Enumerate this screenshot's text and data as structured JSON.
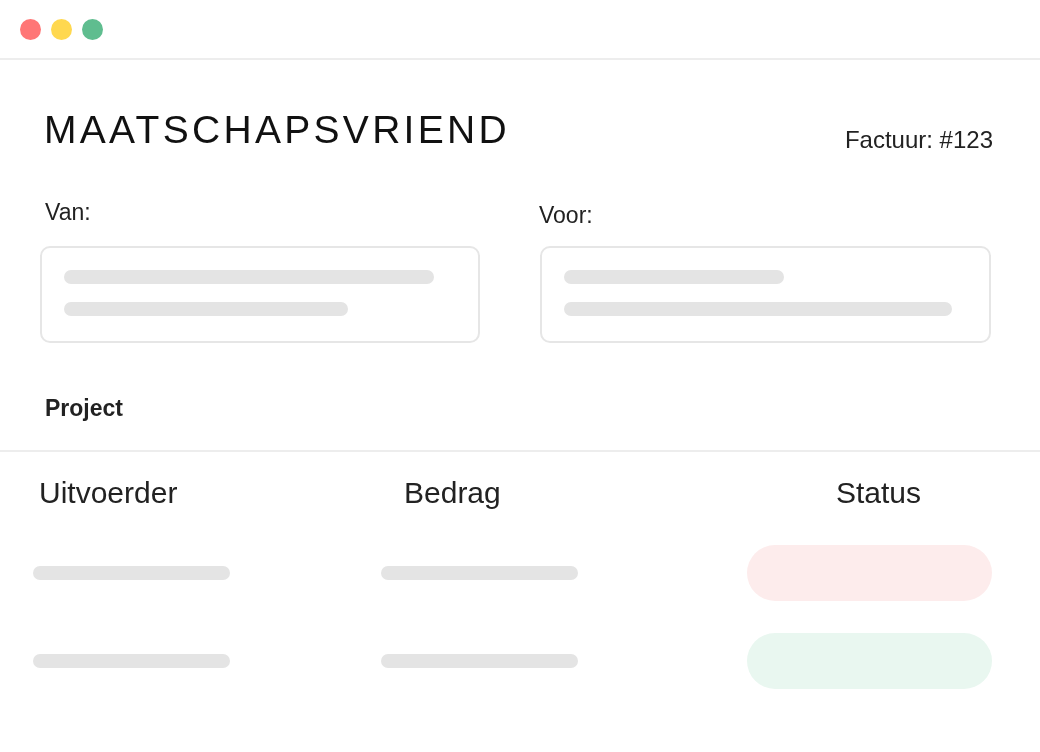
{
  "window": {
    "controls": [
      {
        "kind": "close"
      },
      {
        "kind": "minimize"
      },
      {
        "kind": "maximize"
      }
    ]
  },
  "logo": {
    "text": "MAATSCHAPSVRIEND"
  },
  "invoice_number": "Factuur: #123",
  "from": {
    "label": "Van:"
  },
  "to": {
    "label": "Voor:"
  },
  "project": {
    "heading": "Project"
  },
  "table": {
    "columns": [
      "Uitvoerder",
      "Bedrag",
      "Status"
    ],
    "rows": [
      {
        "color": "#fdecec"
      },
      {
        "color": "#e9f7f0"
      }
    ]
  }
}
